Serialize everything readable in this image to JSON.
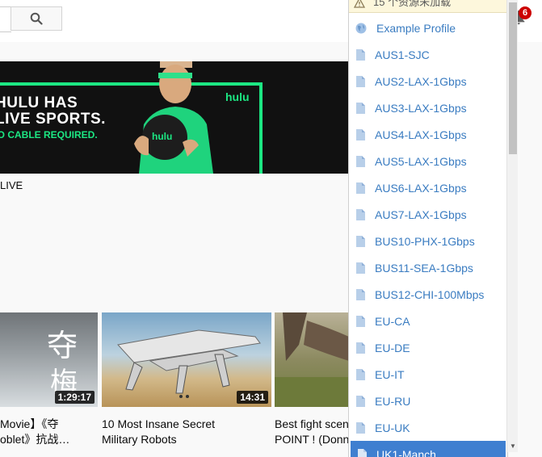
{
  "header": {
    "notification_count": "6"
  },
  "ad": {
    "headline_line1": "HULU HAS",
    "headline_line2": "LIVE SPORTS.",
    "subline": "NO CABLE REQUIRED.",
    "logo": "hulu",
    "ball_logo": "hulu",
    "caption": "LIVE"
  },
  "videos": [
    {
      "thumb_text": "夺梅",
      "duration": "1:29:17",
      "title_line1": "Movie】《夺",
      "title_line2": "oblet》抗战…"
    },
    {
      "duration": "14:31",
      "title_line1": "10 Most Insane Secret",
      "title_line2": "Military Robots"
    },
    {
      "title_line1": "Best fight scen",
      "title_line2": "POINT ! (Donni"
    }
  ],
  "proxy_menu": {
    "warning": "15 个资源未加载",
    "items": [
      {
        "label": "Example Profile",
        "icon": "globe-icon"
      },
      {
        "label": "AUS1-SJC",
        "icon": "document-icon"
      },
      {
        "label": "AUS2-LAX-1Gbps",
        "icon": "document-icon"
      },
      {
        "label": "AUS3-LAX-1Gbps",
        "icon": "document-icon"
      },
      {
        "label": "AUS4-LAX-1Gbps",
        "icon": "document-icon"
      },
      {
        "label": "AUS5-LAX-1Gbps",
        "icon": "document-icon"
      },
      {
        "label": "AUS6-LAX-1Gbps",
        "icon": "document-icon"
      },
      {
        "label": "AUS7-LAX-1Gbps",
        "icon": "document-icon"
      },
      {
        "label": "BUS10-PHX-1Gbps",
        "icon": "document-icon"
      },
      {
        "label": "BUS11-SEA-1Gbps",
        "icon": "document-icon"
      },
      {
        "label": "BUS12-CHI-100Mbps",
        "icon": "document-icon"
      },
      {
        "label": "EU-CA",
        "icon": "document-icon"
      },
      {
        "label": "EU-DE",
        "icon": "document-icon"
      },
      {
        "label": "EU-IT",
        "icon": "document-icon"
      },
      {
        "label": "EU-RU",
        "icon": "document-icon"
      },
      {
        "label": "EU-UK",
        "icon": "document-icon"
      },
      {
        "label": "UK1-Manch...",
        "icon": "document-icon"
      }
    ]
  },
  "colors": {
    "link": "#3a7cc1",
    "selected": "#3f7fd0",
    "hulu_green": "#1ce783",
    "badge": "#cc0000"
  }
}
